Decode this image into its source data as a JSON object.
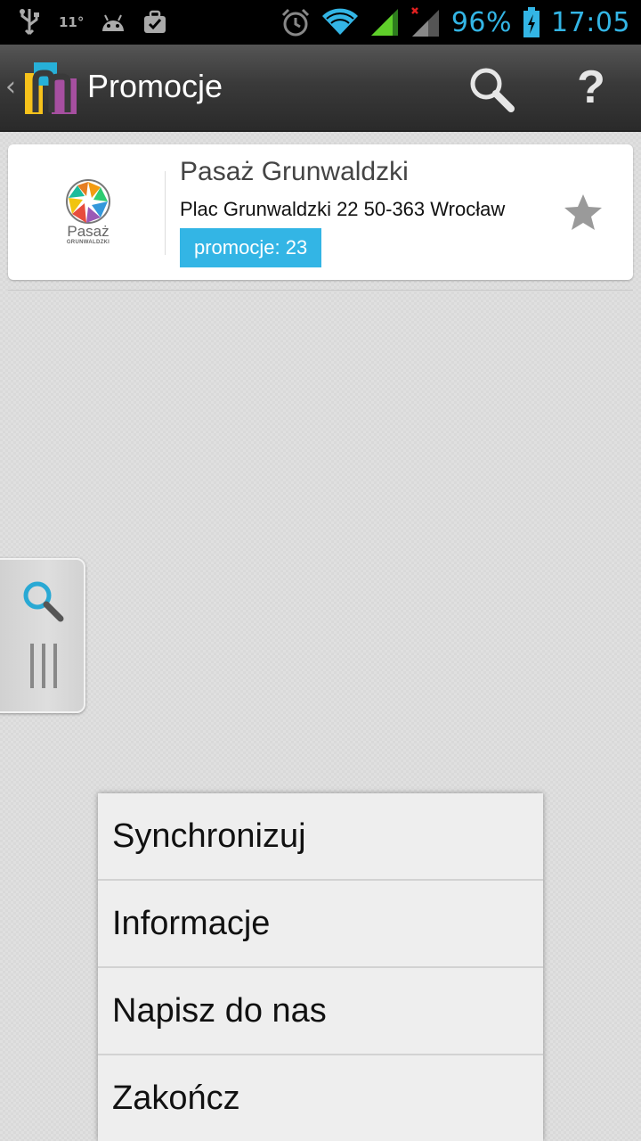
{
  "status_bar": {
    "temperature": "11°",
    "battery_percent": "96%",
    "time": "17:05",
    "icons": [
      "usb-icon",
      "android-icon",
      "briefcase-check-icon",
      "alarm-icon",
      "wifi-icon",
      "signal-icon",
      "signal-no-data-icon",
      "battery-charging-icon"
    ]
  },
  "action_bar": {
    "title": "Promocje",
    "help_label": "?",
    "back_label": "‹",
    "icons": [
      "app-logo-icon",
      "search-icon",
      "help-icon"
    ]
  },
  "mall": {
    "logo_text": "Pasaż",
    "logo_subtext": "GRUNWALDZKI",
    "name": "Pasaż Grunwaldzki",
    "address": "Plac Grunwaldzki 22 50-363 Wrocław",
    "promotions_label": "promocje: 23",
    "favorite_icon": "star-icon"
  },
  "side_handle": {
    "icons": [
      "search-icon",
      "grip-icon"
    ]
  },
  "menu": {
    "items": [
      {
        "label": "Synchronizuj"
      },
      {
        "label": "Informacje"
      },
      {
        "label": "Napisz do nas"
      },
      {
        "label": "Zakończ"
      }
    ]
  },
  "colors": {
    "accent": "#33b5e5",
    "action_bar": "#3a3a3a",
    "background": "#d9d9d9"
  }
}
